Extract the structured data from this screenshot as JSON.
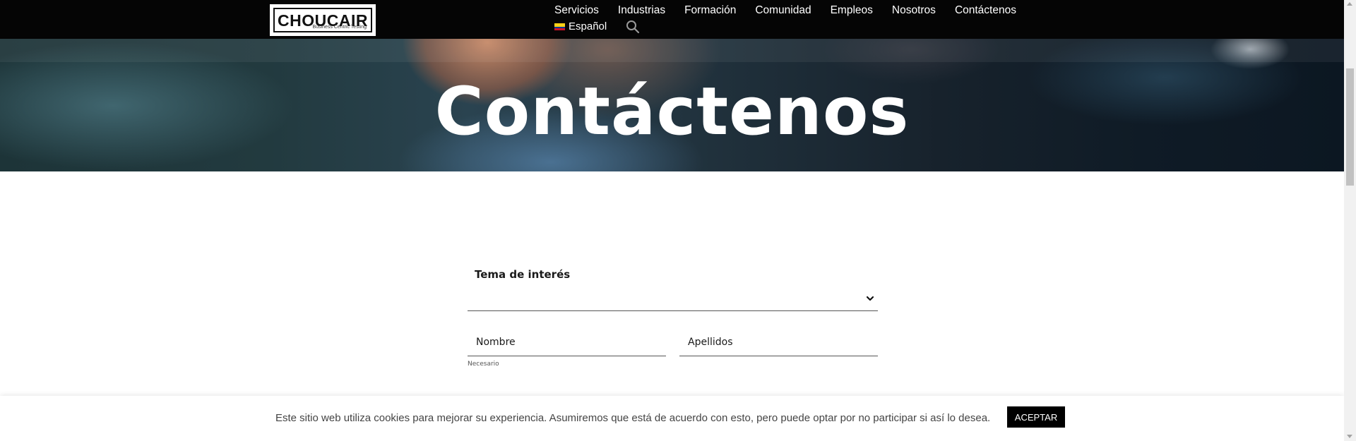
{
  "header": {
    "logo_text": "CHOUCAIR",
    "logo_tagline": "Business Centric Testing",
    "nav": [
      {
        "label": "Servicios"
      },
      {
        "label": "Industrias"
      },
      {
        "label": "Formación"
      },
      {
        "label": "Comunidad"
      },
      {
        "label": "Empleos"
      },
      {
        "label": "Nosotros"
      },
      {
        "label": "Contáctenos"
      }
    ],
    "language": {
      "label": "Español",
      "icon": "flag-colombia-icon"
    },
    "search_icon": "search-icon"
  },
  "hero": {
    "title": "Contáctenos"
  },
  "form": {
    "topic_label": "Tema de interés",
    "topic_value": "",
    "first_name_placeholder": "Nombre",
    "last_name_placeholder": "Apellidos",
    "required_note": "Necesario"
  },
  "cookie_notice": {
    "text": "Este sitio web utiliza cookies para mejorar su experiencia. Asumiremos que está de acuerdo con esto, pero puede optar por no participar si así lo desea.",
    "accept_label": "ACEPTAR"
  },
  "colors": {
    "topbar": "#050505",
    "accent_button": "#000000",
    "hero_text": "#ffffff"
  }
}
